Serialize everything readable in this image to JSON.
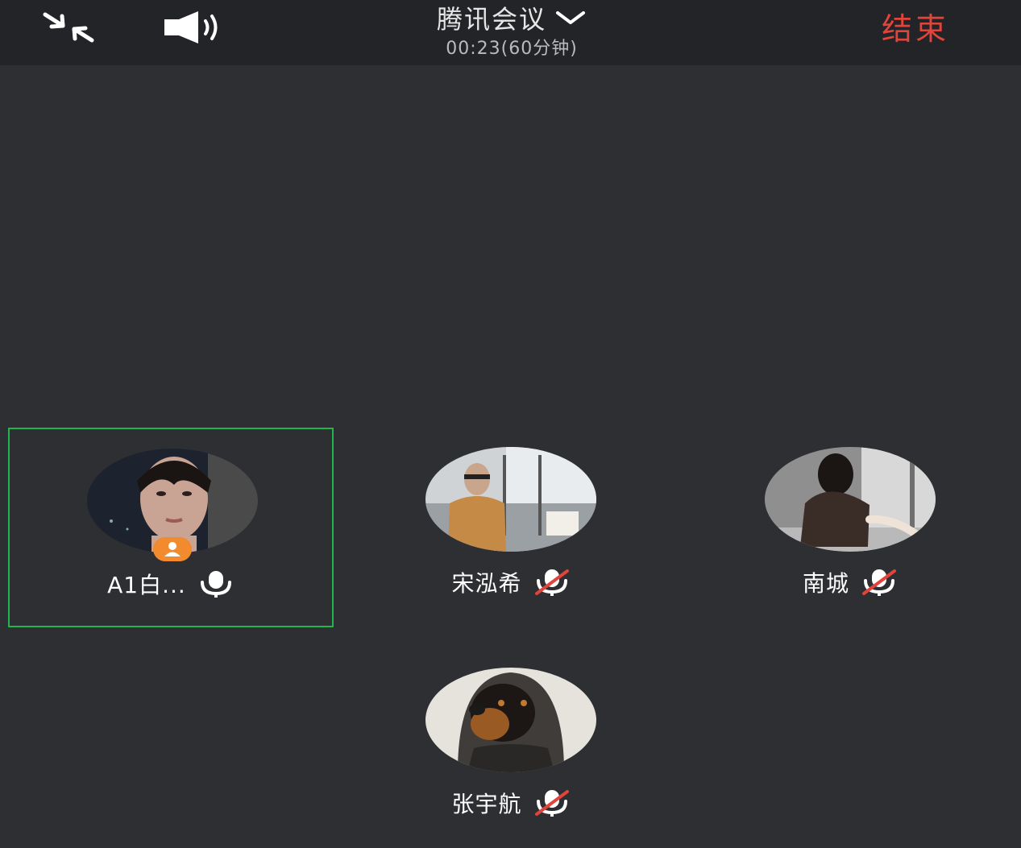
{
  "header": {
    "title": "腾讯会议",
    "timer": "00:23(60分钟)",
    "end_label": "结束",
    "icons": [
      "minimize-icon",
      "speaker-icon",
      "chevron-down-icon"
    ]
  },
  "participants": [
    {
      "name": "A1白...",
      "mic": "on",
      "host": true,
      "active": true
    },
    {
      "name": "宋泓希",
      "mic": "muted",
      "host": false,
      "active": false
    },
    {
      "name": "南城",
      "mic": "muted",
      "host": false,
      "active": false
    },
    {
      "name": "张宇航",
      "mic": "muted",
      "host": false,
      "active": false
    }
  ],
  "colors": {
    "background": "#2d2f33",
    "topbar": "#232427",
    "end": "#e0443b",
    "active_border": "#1fb550",
    "host_badge": "#f28a2e",
    "muted_slash": "#e0443b"
  }
}
